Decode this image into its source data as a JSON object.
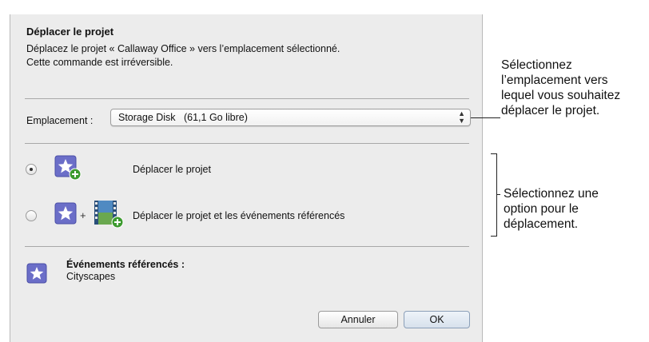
{
  "dialog": {
    "title": "Déplacer le projet",
    "description_line1": "Déplacez le projet « Callaway Office » vers l’emplacement sélectionné.",
    "description_line2": "Cette commande est irréversible.",
    "location_label": "Emplacement :",
    "location_value": "Storage Disk   (61,1 Go libre)",
    "options": [
      {
        "label": "Déplacer le projet",
        "selected": true
      },
      {
        "label": "Déplacer le projet et les événements référencés",
        "selected": false
      }
    ],
    "plus_sign": "+",
    "referenced_title": "Événements référencés :",
    "referenced_items": [
      "Cityscapes"
    ],
    "buttons": {
      "cancel": "Annuler",
      "ok": "OK"
    }
  },
  "callouts": {
    "location": [
      "Sélectionnez",
      "l’emplacement vers",
      "lequel vous souhaitez",
      "déplacer le projet."
    ],
    "option": [
      "Sélectionnez une",
      "option pour le",
      "déplacement."
    ]
  },
  "colors": {
    "dialog_bg": "#ececec",
    "star_icon": "#6b6ec8",
    "plus_badge": "#3c9a2e"
  },
  "icons": [
    "star-icon",
    "add-badge-icon",
    "film-icon"
  ]
}
